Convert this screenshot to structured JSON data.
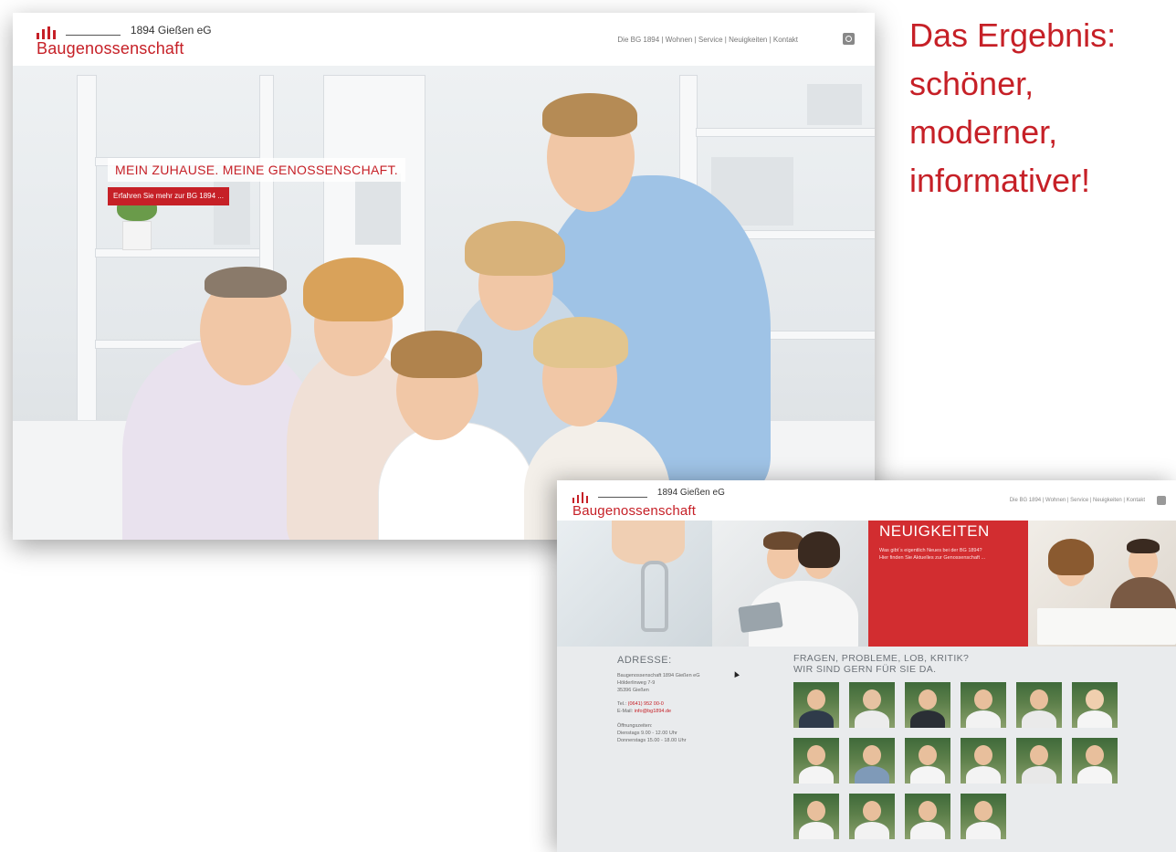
{
  "shot1": {
    "logo": {
      "year_place": "1894 Gießen eG",
      "name": "Baugenossenschaft"
    },
    "nav": "Die BG 1894 | Wohnen | Service | Neuigkeiten | Kontakt",
    "tagline": "MEIN ZUHAUSE. MEINE GENOSSENSCHAFT.",
    "cta": "Erfahren Sie mehr zur BG 1894 ..."
  },
  "headline": {
    "line1": "Das Ergebnis:",
    "line2": "schöner,",
    "line3": "moderner,",
    "line4": "informativer!"
  },
  "shot2": {
    "logo": {
      "year_place": "1894 Gießen eG",
      "name": "Baugenossenschaft"
    },
    "nav": "Die BG 1894 | Wohnen | Service | Neuigkeiten | Kontakt",
    "news": {
      "title": "NEUIGKEITEN",
      "line1": "Was gibt´s eigentlich Neues bei der BG 1894?",
      "line2": "Hier finden Sie Aktuelles zur Genossenschaft ..."
    },
    "address": {
      "heading": "ADRESSE:",
      "line1": "Baugenossenschaft 1894 Gießen eG",
      "line2": "Hölderlinweg 7-9",
      "line3": "35396 Gießen",
      "tel_label": "Tel.:",
      "tel": "(0641) 952 00-0",
      "email_label": "E-Mail:",
      "email": "info@bg1894.de",
      "hours_heading": "Öffnungszeiten:",
      "hours1": "Dienstags 9.00 - 12.00 Uhr",
      "hours2": "Donnerstags 15.00 - 18.00 Uhr"
    },
    "questions": {
      "line1": "FRAGEN, PROBLEME, LOB, KRITIK?",
      "line2": "WIR SIND GERN FÜR SIE DA."
    }
  },
  "colors": {
    "accent": "#c62027",
    "footer_bg": "#e9ebed"
  }
}
